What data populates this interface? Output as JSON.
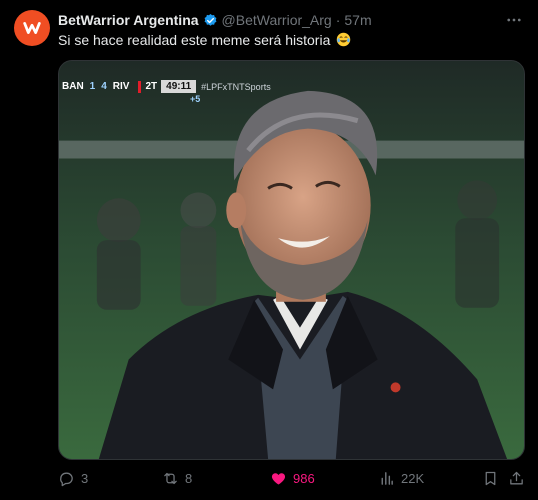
{
  "tweet": {
    "author_name": "BetWarrior Argentina",
    "handle": "@BetWarrior_Arg",
    "separator": "·",
    "time": "57m",
    "text": "Si se hace realidad este meme será historia",
    "emoji": "face-with-tears-of-joy"
  },
  "scoreboard": {
    "home_team": "BAN",
    "home_score": "1",
    "away_score": "4",
    "away_team": "RIV",
    "period": "2T",
    "clock": "49:11",
    "added_time": "+5",
    "hashtag": "#LPFxTNTSports"
  },
  "actions": {
    "replies": "3",
    "reposts": "8",
    "likes": "986",
    "views": "22K"
  },
  "colors": {
    "background": "#000000",
    "text": "#e7e9ea",
    "muted": "#71767b",
    "verified": "#1d9bf0",
    "like": "#f91880",
    "brand": "#f04e23"
  }
}
